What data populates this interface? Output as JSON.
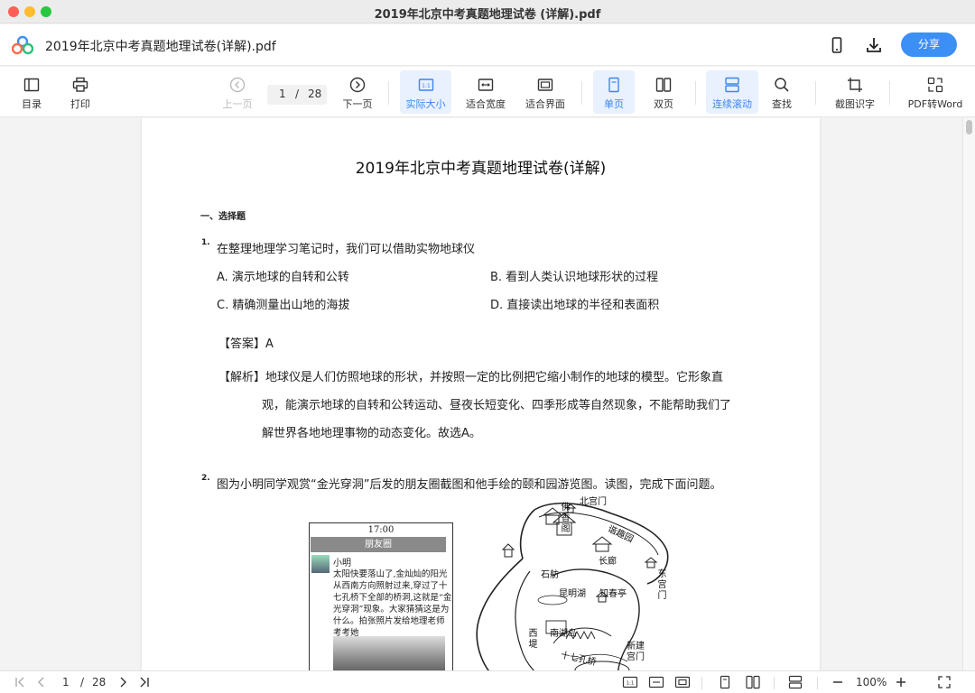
{
  "window": {
    "title": "2019年北京中考真题地理试卷 (详解).pdf"
  },
  "header": {
    "doc_title": "2019年北京中考真题地理试卷(详解).pdf",
    "share_label": "分享",
    "phone_icon": "phone-icon",
    "download_icon": "download-icon"
  },
  "toolbar": {
    "toc": "目录",
    "print": "打印",
    "prev_page": "上一页",
    "current_page": "1",
    "page_sep": "/",
    "total_pages": "28",
    "next_page": "下一页",
    "actual_size": "实际大小",
    "fit_width": "适合宽度",
    "fit_window": "适合界面",
    "single_page": "单页",
    "double_page": "双页",
    "continuous_scroll": "连续滚动",
    "find": "查找",
    "ocr": "截图识字",
    "pdf_to_word": "PDF转Word",
    "actual_size_icon_text": "1:1"
  },
  "document": {
    "title": "2019年北京中考真题地理试卷(详解)",
    "section": "一、选择题",
    "q1": {
      "num": "1.",
      "text": "在整理地理学习笔记时，我们可以借助实物地球仪",
      "options": {
        "a": "A. 演示地球的自转和公转",
        "b": "B. 看到人类认识地球形状的过程",
        "c": "C. 精确测量出山地的海拔",
        "d": "D. 直接读出地球的半径和表面积"
      },
      "answer_label": "【答案】",
      "answer": "A",
      "analysis_label": "【解析】",
      "analysis_line1": "地球仪是人们仿照地球的形状，并按照一定的比例把它缩小制作的地球的模型。它形象直",
      "analysis_line2": "观，能演示地球的自转和公转运动、昼夜长短变化、四季形成等自然现象，不能帮助我们了",
      "analysis_line3": "解世界各地地理事物的动态变化。故选A。"
    },
    "q2": {
      "num": "2.",
      "text": "图为小明同学观赏“金光穿洞”后发的朋友圈截图和他手绘的颐和园游览图。读图，完成下面问题。"
    },
    "moments": {
      "time": "17:00",
      "header": "朋友圈",
      "user": "小明",
      "message": "太阳快要落山了,金灿灿的阳光从西南方向照射过来,穿过了十七孔桥下全部的桥洞,这就是“金光穿洞”现象。大家猜猜这是为什么。拍张照片发给地理老师考考她"
    },
    "map": {
      "north_gate": "北宫门",
      "foxiangge": "佛香阁",
      "xiequyuan": "谐趣园",
      "shifang": "石舫",
      "changlang": "长廊",
      "east_gate": "东宫门",
      "kunming_lake": "昆明湖",
      "zhichunting": "知春亭",
      "nanhudao": "南湖岛",
      "west_dike": "西堤",
      "new_gate": "新建宫门",
      "bridge": "十七孔桥"
    }
  },
  "statusbar": {
    "current_page": "1",
    "sep": "/",
    "total_pages": "28",
    "zoom": "100%"
  }
}
